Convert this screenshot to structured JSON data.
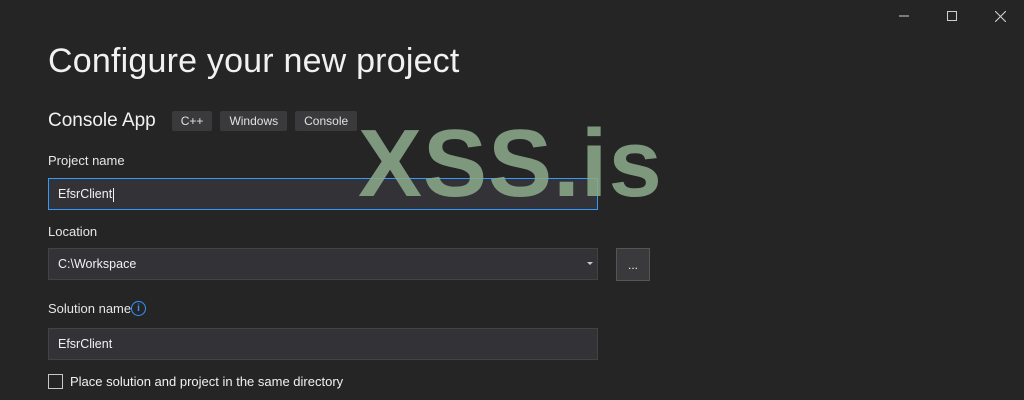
{
  "window": {
    "minimize_icon": "minimize-icon",
    "maximize_icon": "maximize-icon",
    "close_icon": "close-icon"
  },
  "page": {
    "title": "Configure your new project"
  },
  "template": {
    "name": "Console App",
    "tags": [
      "C++",
      "Windows",
      "Console"
    ]
  },
  "project_name": {
    "label": "Project name",
    "value": "EfsrClient"
  },
  "location": {
    "label": "Location",
    "value": "C:\\Workspace",
    "browse_label": "..."
  },
  "solution_name": {
    "label": "Solution name",
    "info_icon": "i",
    "value": "EfsrClient"
  },
  "same_directory": {
    "label": "Place solution and project in the same directory",
    "checked": false
  },
  "watermark": {
    "text": "XSS.is"
  },
  "colors": {
    "background": "#252526",
    "focus_border": "#3399ff",
    "info_accent": "#3794ff"
  }
}
